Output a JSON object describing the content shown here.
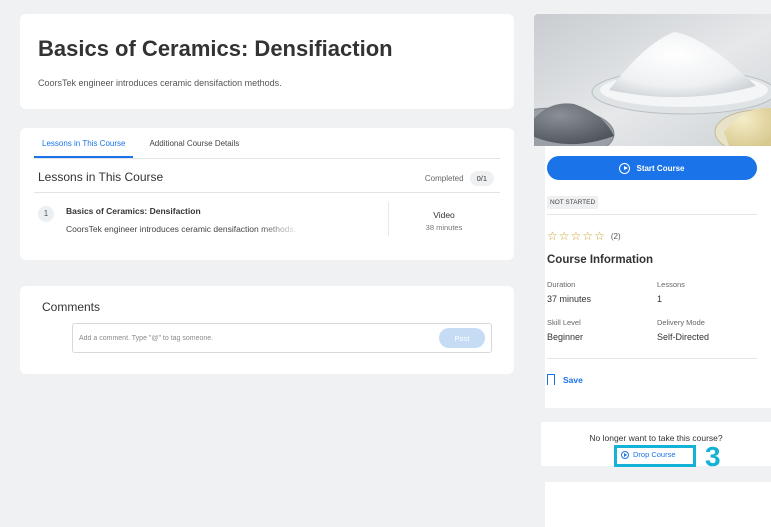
{
  "header": {
    "title": "Basics of Ceramics: Densifiaction",
    "subtitle": "CoorsTek engineer introduces ceramic densifaction methods."
  },
  "tabs": [
    {
      "label": "Lessons in This Course",
      "active": true
    },
    {
      "label": "Additional Course Details",
      "active": false
    }
  ],
  "lessons": {
    "heading": "Lessons in This Course",
    "completed_label": "Completed",
    "completed_count": "0/1",
    "items": [
      {
        "number": "1",
        "title": "Basics of Ceramics: Densifaction",
        "description": "CoorsTek engineer introduces ceramic densifaction methods.",
        "type": "Video",
        "duration": "38 minutes"
      }
    ]
  },
  "comments": {
    "title": "Comments",
    "placeholder": "Add a comment. Type \"@\" to tag someone.",
    "post_label": "Post"
  },
  "sidebar": {
    "start_label": "Start Course",
    "status": "NOT STARTED",
    "rating_stars": 5,
    "rating_count": "(2)",
    "info_title": "Course Information",
    "duration_label": "Duration",
    "duration_value": "37 minutes",
    "lessons_label": "Lessons",
    "lessons_value": "1",
    "skill_label": "Skill Level",
    "skill_value": "Beginner",
    "delivery_label": "Delivery Mode",
    "delivery_value": "Self-Directed",
    "save_label": "Save"
  },
  "drop": {
    "question": "No longer want to take this course?",
    "button_label": "Drop Course",
    "step_number": "3"
  },
  "colors": {
    "accent": "#1a73e8",
    "highlight": "#14b2d6",
    "star": "#c9a227"
  }
}
